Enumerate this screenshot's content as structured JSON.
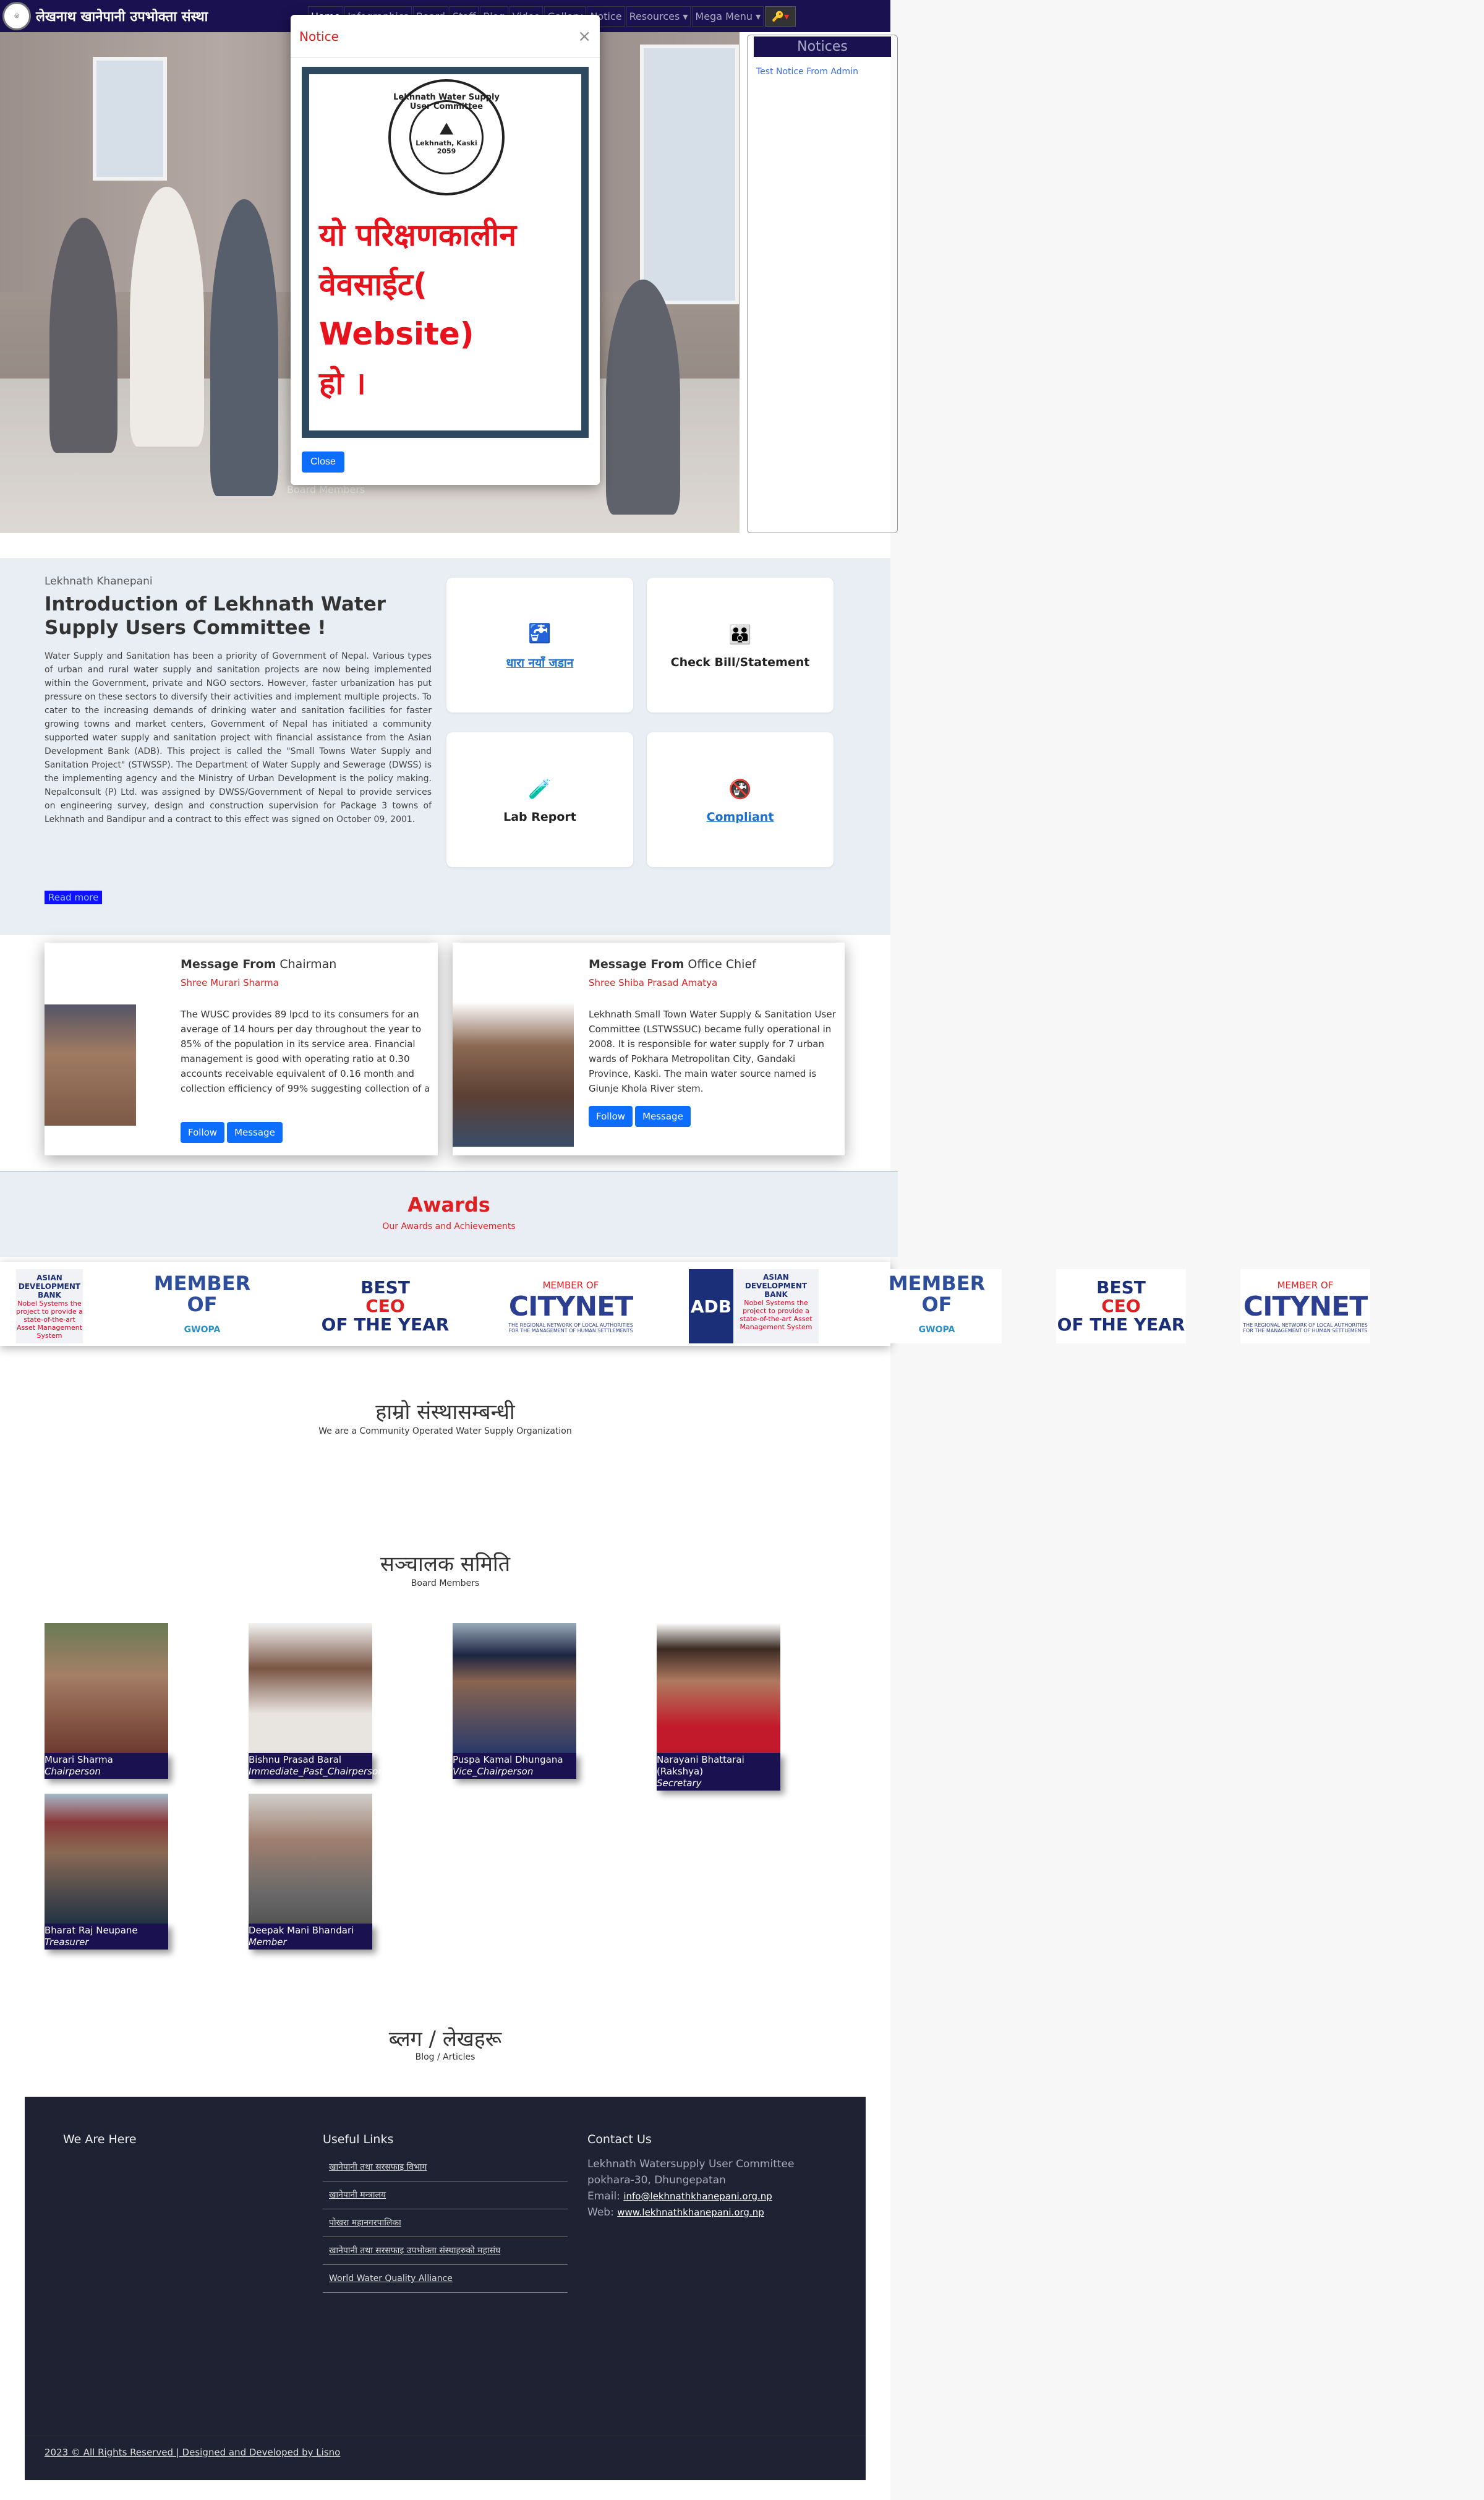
{
  "nav": {
    "brand": "लेखनाथ खानेपानी उपभोक्ता संस्था",
    "items": [
      "Home",
      "Infographics",
      "Board",
      "Staff",
      "Blog",
      "Video",
      "Gallery",
      "Notice",
      "Resources ▾",
      "Mega Menu ▾"
    ],
    "key_icon": "key-icon"
  },
  "hero": {
    "caption": "Board Members"
  },
  "notices": {
    "heading": "Notices",
    "items": [
      "Test Notice From Admin"
    ]
  },
  "modal": {
    "title": "Notice",
    "close_x": "×",
    "seal_ring": "Lekhnath Water Supply User Committee",
    "seal_center": "Lekhnath, Kaski",
    "seal_year": "2059",
    "image_text_line1": "यो परिक्षणकालीन",
    "image_text_line2": "वेवसाईट( Website)",
    "image_text_line3": "हो ।",
    "close_button": "Close"
  },
  "intro": {
    "label": "Lekhnath Khanepani",
    "title": "Introduction of Lekhnath Water Supply Users Committee !",
    "body": "Water Supply and Sanitation has been a priority of Government of Nepal. Various types of urban and rural water supply and sanitation projects are now being implemented within the Government, private and NGO sectors. However, faster urbanization has put pressure on these sectors to diversify their activities and implement multiple projects. To cater to the increasing demands of drinking water and sanitation facilities for faster growing towns and market centers, Government of Nepal has initiated a community supported water supply and sanitation project with financial assistance from the Asian Development Bank (ADB). This project is called the \"Small Towns Water Supply and Sanitation Project\" (STWSSP). The Department of Water Supply and Sewerage (DWSS) is the implementing agency and the Ministry of Urban Development is the policy making. Nepalconsult (P) Ltd. was assigned by DWSS/Government of Nepal to provide services on engineering survey, design and construction supervision for Package 3 towns of Lekhnath and Bandipur and a contract to this effect was signed on October 09, 2001.",
    "read_more": "Read more"
  },
  "services": [
    {
      "label": "धारा नयाँ जडान",
      "icon": "water-tap-icon",
      "link": true
    },
    {
      "label": "Check Bill/Statement",
      "icon": "family-icon",
      "link": false
    },
    {
      "label": "Lab Report",
      "icon": "lab-icon",
      "link": false
    },
    {
      "label": "Compliant",
      "icon": "complaint-icon",
      "link": true
    }
  ],
  "messages": [
    {
      "heading_bold": "Message From",
      "heading_role": "Chairman",
      "name": "Shree Murari Sharma",
      "text": "The WUSC provides 89 lpcd to its consumers for an average of 14 hours per day throughout the year to 85% of the population in its service area. Financial management is good with operating ratio at 0.30 accounts receivable equivalent of 0.16 month and collection efficiency of 99% suggesting collection of a",
      "follow": "Follow",
      "message": "Message"
    },
    {
      "heading_bold": "Message From",
      "heading_role": "Office Chief",
      "name": "Shree Shiba Prasad Amatya",
      "text": "Lekhnath Small Town Water Supply & Sanitation User Committee (LSTWSSUC) became fully operational in 2008. It is responsible for water supply for 7 urban wards of Pokhara Metropolitan City, Gandaki Province, Kaski. The main water source named is Giunje Khola River stem.",
      "follow": "Follow",
      "message": "Message"
    }
  ],
  "awards": {
    "title": "Awards",
    "subtitle": "Our Awards and Achievements",
    "adb_header": "ASIAN DEVELOPMENT BANK",
    "adb_body": "Nobel Systems the project to provide a state-of-the-art Asset Management System",
    "adb_mark": "ADB",
    "gwopa_line1": "MEMBER OF",
    "gwopa_line2": "GWOPA",
    "ceo_line1": "BEST",
    "ceo_line2": "CEO",
    "ceo_line3": "OF THE YEAR",
    "citynet_line1": "MEMBER OF",
    "citynet_line2": "CITYNET",
    "citynet_line3": "THE REGIONAL NETWORK OF LOCAL AUTHORITIES FOR THE MANAGEMENT OF HUMAN SETTLEMENTS"
  },
  "org": {
    "title": "हाम्रो संस्थासम्बन्धी",
    "subtitle": "We are a Community Operated Water Supply Organization"
  },
  "board": {
    "title": "सञ्चालक समिति",
    "subtitle": "Board Members",
    "members": [
      {
        "name": "Murari Sharma",
        "role": "Chairperson"
      },
      {
        "name": "Bishnu Prasad Baral",
        "role": "Immediate_Past_Chairperson"
      },
      {
        "name": "Puspa Kamal Dhungana",
        "role": "Vice_Chairperson"
      },
      {
        "name": "Narayani Bhattarai (Rakshya)",
        "role": "Secretary"
      },
      {
        "name": "Bharat Raj Neupane",
        "role": "Treasurer"
      },
      {
        "name": "Deepak Mani Bhandari",
        "role": "Member"
      }
    ]
  },
  "blog": {
    "title": "ब्लग / लेखहरू",
    "subtitle": "Blog / Articles"
  },
  "footer": {
    "col1": "We Are Here",
    "col2": "Useful Links",
    "col3": "Contact Us",
    "links": [
      "खानेपानी तथा सरसफाइ विभाग",
      "खानेपानी मन्त्रालय",
      "पोखरा महानगरपालिका",
      "खानेपानी तथा सरसफाइ उपभोक्ता संस्थाहरुको महासंघ",
      "World Water Quality Alliance"
    ],
    "org": "Lekhnath Watersupply User Committee",
    "address": "pokhara-30, Dhungepatan",
    "email_label": "Email:",
    "email": "info@lekhnathkhanepani.org.np",
    "web_label": "Web:",
    "web": "www.lekhnathkhanepani.org.np",
    "copyright": "2023 © All Rights Reserved | Designed and Developed by Lisno"
  }
}
